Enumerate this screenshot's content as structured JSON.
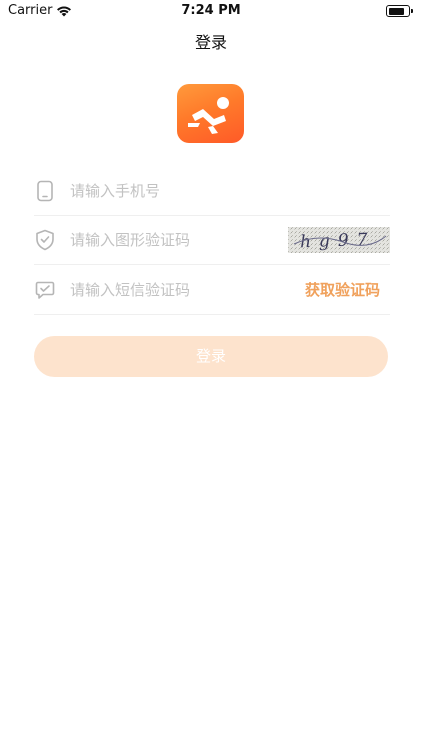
{
  "status_bar": {
    "carrier": "Carrier",
    "time": "7:24 PM",
    "icons": [
      "wifi-icon",
      "battery-icon"
    ]
  },
  "nav": {
    "title": "登录"
  },
  "logo": {
    "icon": "runner-icon",
    "colors": [
      "#ff9a3c",
      "#ff5a28"
    ]
  },
  "form": {
    "phone": {
      "placeholder": "请输入手机号",
      "icon": "phone-icon"
    },
    "captcha": {
      "placeholder": "请输入图形验证码",
      "icon": "shield-icon",
      "captcha_text": "hg97"
    },
    "sms": {
      "placeholder": "请输入短信验证码",
      "icon": "message-icon",
      "get_code_label": "获取验证码"
    }
  },
  "login_button": {
    "label": "登录"
  },
  "colors": {
    "accent": "#f0a15c",
    "button_bg": "#fde3cd",
    "placeholder": "#c2c2c2"
  }
}
